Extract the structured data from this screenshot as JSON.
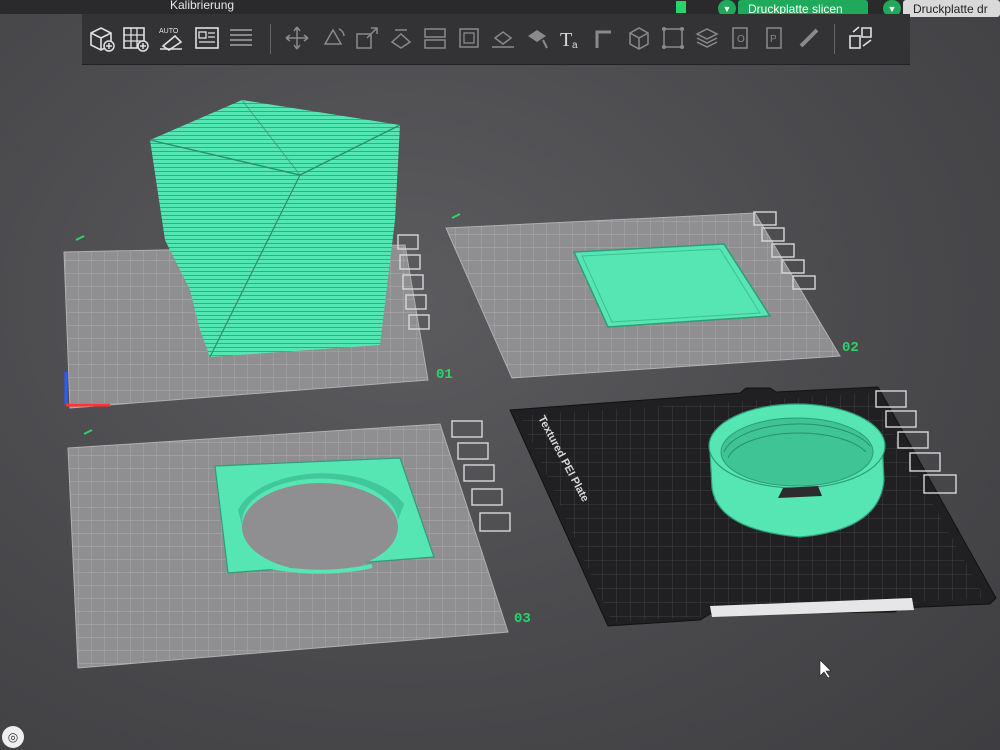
{
  "menubar": {
    "item_partial": "Kalibrierung"
  },
  "actions": {
    "slice_label": "Druckplatte slicen",
    "send_label": "Druckplatte dr"
  },
  "toolbar": {
    "tools": [
      "add-cube-icon",
      "grid-icon",
      "auto-orient-icon",
      "layout-icon",
      "list-icon",
      "move-icon",
      "rotate-icon",
      "scale-icon",
      "lay-on-face-icon",
      "split-icon",
      "cut-icon",
      "support-icon",
      "seam-icon",
      "text-icon",
      "measure-icon",
      "assembly-icon",
      "variable-layer-icon",
      "layers-icon",
      "plate-icon",
      "profile-icon",
      "ruler-icon",
      "arrange-icon"
    ]
  },
  "plates": [
    {
      "number": "01",
      "object": "twisted vase"
    },
    {
      "number": "02",
      "object": "flat rectangle"
    },
    {
      "number": "03",
      "object": "ring insert"
    },
    {
      "number": "",
      "object": "threaded cap",
      "bed_label": "Textured PEI Plate"
    }
  ],
  "colors": {
    "model": "#55e6b4",
    "accent": "#2bd46a",
    "plate": "#9a9a9c"
  }
}
